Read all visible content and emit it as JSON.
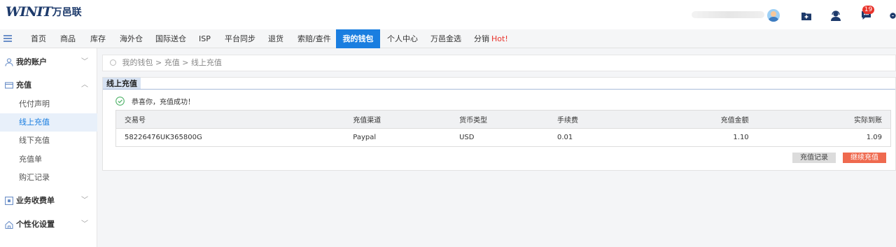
{
  "brand": {
    "mark": "WINIT",
    "name_cn": "万邑联"
  },
  "header": {
    "notification_count": "19"
  },
  "nav": {
    "items": [
      "首页",
      "商品",
      "库存",
      "海外仓",
      "国际送仓",
      "ISP",
      "平台同步",
      "退货",
      "索赔/查件",
      "我的钱包",
      "个人中心",
      "万邑金选",
      "分销"
    ],
    "hot_label": "Hot!",
    "active": "我的钱包"
  },
  "sidebar": {
    "groups": [
      {
        "label": "我的账户",
        "icon": "user-icon"
      },
      {
        "label": "充值",
        "icon": "wallet-icon"
      },
      {
        "label": "业务收费单",
        "icon": "bill-icon"
      },
      {
        "label": "个性化设置",
        "icon": "home-settings-icon"
      }
    ],
    "recharge_items": [
      "代付声明",
      "线上充值",
      "线下充值",
      "充值单",
      "购汇记录"
    ],
    "active_item": "线上充值"
  },
  "breadcrumb": {
    "parts": [
      "我的钱包",
      "充值",
      "线上充值"
    ],
    "separator": ">"
  },
  "panel": {
    "tab_label": "线上充值",
    "success_message": "恭喜你，充值成功！",
    "columns": [
      "交易号",
      "充值渠道",
      "货币类型",
      "手续费",
      "充值金额",
      "实际到账"
    ],
    "rows": [
      [
        "58226476UK365800G",
        "Paypal",
        "USD",
        "0.01",
        "1.10",
        "1.09"
      ]
    ],
    "buttons": {
      "history": "充值记录",
      "continue": "继续充值"
    }
  },
  "colors": {
    "accent": "#1a7ee0",
    "danger": "#ef6a4f",
    "hot": "#e8332b",
    "success": "#52b36b"
  }
}
